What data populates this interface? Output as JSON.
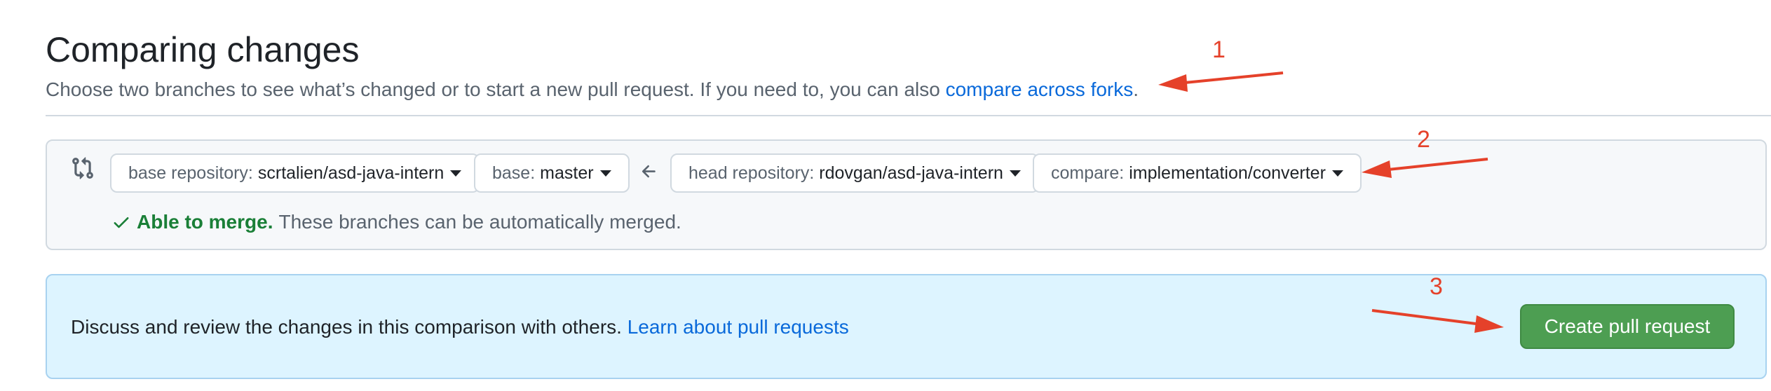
{
  "header": {
    "title": "Comparing changes",
    "subtitle_text": "Choose two branches to see what’s changed or to start a new pull request. If you need to, you can also ",
    "subtitle_link": "compare across forks",
    "subtitle_end": "."
  },
  "compare": {
    "base_repository": {
      "label": "base repository:",
      "value": "scrtalien/asd-java-intern"
    },
    "base": {
      "label": "base:",
      "value": "master"
    },
    "head_repository": {
      "label": "head repository:",
      "value": "rdovgan/asd-java-intern"
    },
    "compare_branch": {
      "label": "compare:",
      "value": "implementation/converter"
    },
    "merge_status": {
      "ok_text": "Able to merge.",
      "detail": "These branches can be automatically merged."
    }
  },
  "pull_request": {
    "text": "Discuss and review the changes in this comparison with others. ",
    "link": "Learn about pull requests",
    "create_button": "Create pull request"
  },
  "annotations": {
    "one": "1",
    "two": "2",
    "three": "3",
    "color": "#e5412a"
  },
  "colors": {
    "link": "#0969da",
    "success": "#1a7f37",
    "button_green": "#4d9e52",
    "info_background": "#ddf4ff"
  }
}
